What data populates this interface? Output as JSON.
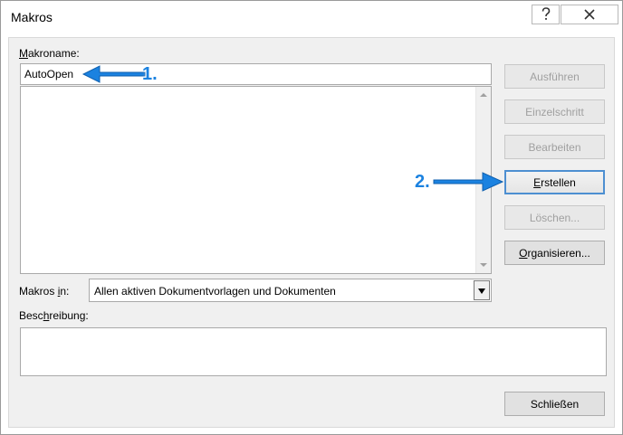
{
  "window": {
    "title": "Makros",
    "help_icon": "question-mark-icon",
    "close_icon": "close-x-icon"
  },
  "form": {
    "macro_name_label_ul": "M",
    "macro_name_label_rest": "akroname:",
    "macro_name_value": "AutoOpen",
    "macros_in_label_pre": "Makros ",
    "macros_in_label_ul": "i",
    "macros_in_label_post": "n:",
    "macros_in_value": "Allen aktiven Dokumentvorlagen und Dokumenten",
    "description_label_pre": "Besc",
    "description_label_ul": "h",
    "description_label_post": "reibung:",
    "description_value": ""
  },
  "buttons": {
    "run": "Ausführen",
    "step_into": "Einzelschritt",
    "edit": "Bearbeiten",
    "create_ul": "E",
    "create_rest": "rstellen",
    "delete": "Löschen...",
    "organizer_ul": "O",
    "organizer_rest": "rganisieren...",
    "close": "Schließen"
  },
  "annotations": {
    "step1": "1.",
    "step2": "2.",
    "color": "#1b82e0"
  }
}
